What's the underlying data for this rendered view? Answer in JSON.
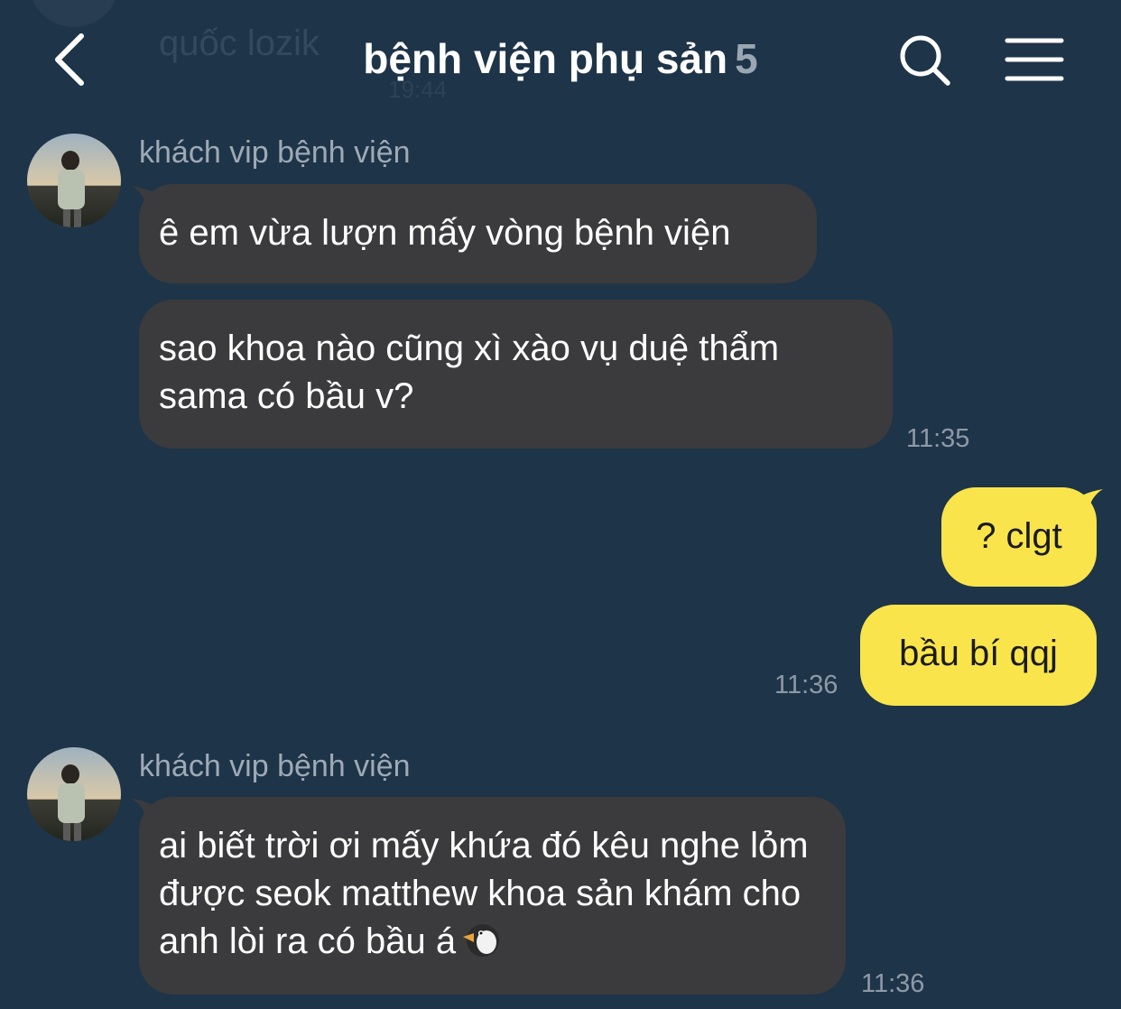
{
  "ghost": {
    "name": "quốc lozik",
    "time": "19:44"
  },
  "header": {
    "back_icon": "chevron-left-icon",
    "title": "bệnh viện phụ sản",
    "member_count": "5",
    "search_icon": "search-icon",
    "menu_icon": "hamburger-menu-icon"
  },
  "messages": [
    {
      "direction": "incoming",
      "sender": "khách vip bệnh viện",
      "bubbles": [
        "ê em vừa lượn mấy vòng bệnh viện",
        "sao khoa nào cũng xì xào vụ duệ thẩm sama có bầu v?"
      ],
      "time": "11:35"
    },
    {
      "direction": "outgoing",
      "bubbles": [
        "? clgt",
        "bầu bí qqj"
      ],
      "time": "11:36"
    },
    {
      "direction": "incoming",
      "sender": "khách vip bệnh viện",
      "bubbles": [
        "ai biết trời ơi mấy khứa đó kêu nghe lỏm được seok matthew khoa sản khám cho anh lòi ra có bầu á"
      ],
      "emoji": "penguin-emoji",
      "time": "11:36"
    }
  ],
  "colors": {
    "background": "#1e3448",
    "incoming_bubble": "#3b3b3d",
    "outgoing_bubble": "#f9e54b",
    "sender_name": "#9eaab6",
    "timestamp": "#8e9aa6"
  }
}
